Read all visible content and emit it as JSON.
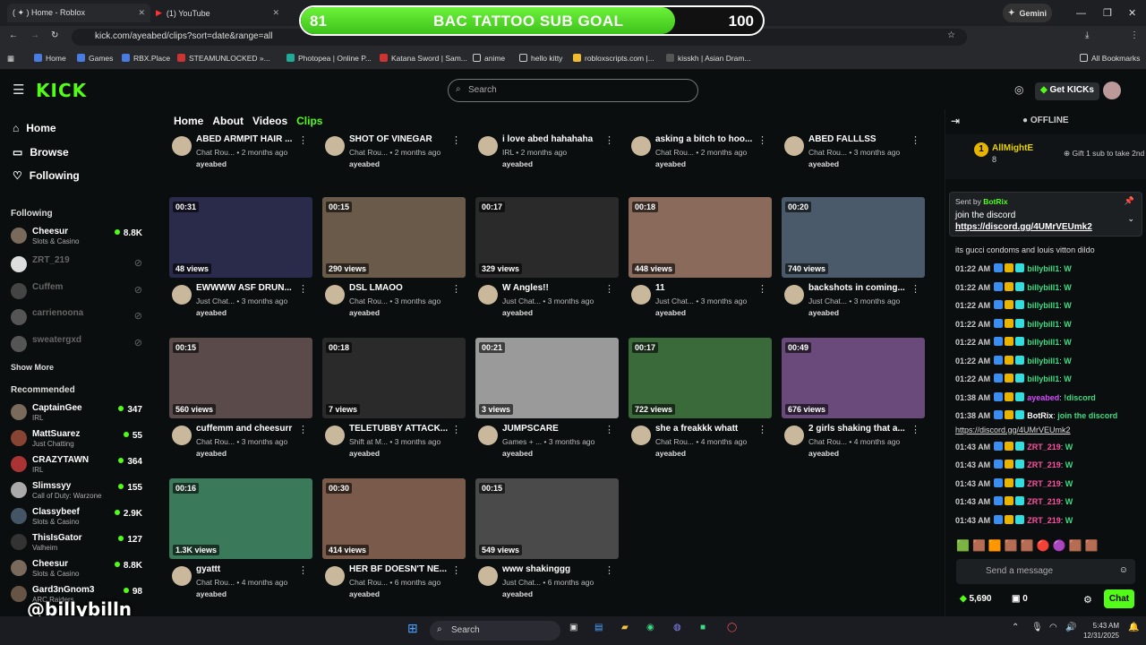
{
  "browser": {
    "tabs": [
      {
        "label": "( ✦ ) Home - Roblox"
      },
      {
        "label": "(1) YouTube"
      }
    ],
    "gemini": "Gemini",
    "url": "kick.com/ayeabed/clips?sort=date&range=all",
    "bookmarks": [
      "Home",
      "Games",
      "RBX.Place",
      "STEAMUNLOCKED »...",
      "Photopea | Online P...",
      "Katana Sword | Sam...",
      "anime",
      "hello kitty",
      "robloxscripts.com |...",
      "kisskh | Asian Dram..."
    ],
    "all_bookmarks": "All Bookmarks"
  },
  "goal": {
    "current": "81",
    "label": "BAC TATTOO SUB GOAL",
    "target": "100",
    "progress": 0.81
  },
  "site": {
    "logo": "KICK",
    "search_placeholder": "Search",
    "get_kicks": "Get KICKs"
  },
  "sidebar": {
    "home": "Home",
    "browse": "Browse",
    "following": "Following",
    "following_title": "Following",
    "following_list": [
      {
        "name": "Cheesur",
        "game": "Slots & Casino",
        "viewers": "8.8K",
        "live": true
      },
      {
        "name": "ZRT_219",
        "live": false
      },
      {
        "name": "Cuffem",
        "live": false
      },
      {
        "name": "carrienoona",
        "live": false
      },
      {
        "name": "sweatergxd",
        "live": false
      }
    ],
    "show_more": "Show More",
    "recommended_title": "Recommended",
    "recommended": [
      {
        "name": "CaptainGee",
        "game": "IRL",
        "viewers": "347"
      },
      {
        "name": "MattSuarez",
        "game": "Just Chatting",
        "viewers": "55"
      },
      {
        "name": "CRAZYTAWN",
        "game": "IRL",
        "viewers": "364"
      },
      {
        "name": "Slimssyy",
        "game": "Call of Duty: Warzone",
        "viewers": "155"
      },
      {
        "name": "Classybeef",
        "game": "Slots & Casino",
        "viewers": "2.9K"
      },
      {
        "name": "ThisIsGator",
        "game": "Valheim",
        "viewers": "127"
      },
      {
        "name": "Cheesur",
        "game": "Slots & Casino",
        "viewers": "8.8K"
      },
      {
        "name": "Gard3nGnom3",
        "game": "ARC Raiders",
        "viewers": "98"
      }
    ]
  },
  "channel_tabs": [
    "Home",
    "About",
    "Videos",
    "Clips"
  ],
  "clips": [
    {
      "title": "ABED ARMPIT HAIR ...",
      "cat": "Chat Rou...",
      "age": "2 months ago",
      "user": "ayeabed"
    },
    {
      "title": "SHOT OF VINEGAR",
      "cat": "Chat Rou...",
      "age": "2 months ago",
      "user": "ayeabed"
    },
    {
      "title": "i love abed hahahaha",
      "cat": "IRL",
      "age": "2 months ago",
      "user": "ayeabed"
    },
    {
      "title": "asking a bitch to hoo...",
      "cat": "Chat Rou...",
      "age": "2 months ago",
      "user": "ayeabed"
    },
    {
      "title": "ABED FALLLSS",
      "cat": "Chat Rou...",
      "age": "3 months ago",
      "user": "ayeabed"
    },
    {
      "dur": "00:31",
      "views": "48 views",
      "title": "EWWWW ASF DRUN...",
      "cat": "Just Chat...",
      "age": "3 months ago",
      "user": "ayeabed",
      "color": "#2a2a4a"
    },
    {
      "dur": "00:15",
      "views": "290 views",
      "title": "DSL LMAOO",
      "cat": "Chat Rou...",
      "age": "3 months ago",
      "user": "ayeabed",
      "color": "#6a5a4a"
    },
    {
      "dur": "00:17",
      "views": "329 views",
      "title": "W Angles!!",
      "cat": "Just Chat...",
      "age": "3 months ago",
      "user": "ayeabed",
      "color": "#2a2a2a"
    },
    {
      "dur": "00:18",
      "views": "448 views",
      "title": "11",
      "cat": "Just Chat...",
      "age": "3 months ago",
      "user": "ayeabed",
      "color": "#8a6a5a"
    },
    {
      "dur": "00:20",
      "views": "740 views",
      "title": "backshots in coming...",
      "cat": "Just Chat...",
      "age": "3 months ago",
      "user": "ayeabed",
      "color": "#4a5a6a"
    },
    {
      "dur": "00:15",
      "views": "560 views",
      "title": "cuffemm and cheesurr",
      "cat": "Chat Rou...",
      "age": "3 months ago",
      "user": "ayeabed",
      "color": "#5a4a4a"
    },
    {
      "dur": "00:18",
      "views": "7 views",
      "title": "TELETUBBY ATTACK...",
      "cat": "Shift at M...",
      "age": "3 months ago",
      "user": "ayeabed",
      "color": "#2a2a2a"
    },
    {
      "dur": "00:21",
      "views": "3 views",
      "title": "JUMPSCARE",
      "cat": "Games + ...",
      "age": "3 months ago",
      "user": "ayeabed",
      "color": "#9a9a9a"
    },
    {
      "dur": "00:17",
      "views": "722 views",
      "title": "she a freakkk whatt",
      "cat": "Chat Rou...",
      "age": "4 months ago",
      "user": "ayeabed",
      "color": "#3a6a3a"
    },
    {
      "dur": "00:49",
      "views": "676 views",
      "title": "2 girls shaking that a...",
      "cat": "Chat Rou...",
      "age": "4 months ago",
      "user": "ayeabed",
      "color": "#6a4a7a"
    },
    {
      "dur": "00:16",
      "views": "1.3K views",
      "title": "gyattt",
      "cat": "Chat Rou...",
      "age": "4 months ago",
      "user": "ayeabed",
      "color": "#3a7a5a"
    },
    {
      "dur": "00:30",
      "views": "414 views",
      "title": "HER BF DOESN'T NE...",
      "cat": "Chat Rou...",
      "age": "6 months ago",
      "user": "ayeabed",
      "color": "#7a5a4a"
    },
    {
      "dur": "00:15",
      "views": "549 views",
      "title": "www shakinggg",
      "cat": "Just Chat...",
      "age": "6 months ago",
      "user": "ayeabed",
      "color": "#4a4a4a"
    }
  ],
  "chat": {
    "offline": "OFFLINE",
    "gifter": "AllMightE",
    "gifter_count": "8",
    "gift_text": "Gift 1 sub to take 2nd",
    "pinned_by": "Sent by",
    "pinned_user": "BotRix",
    "pinned_text": "join the discord",
    "pinned_link": "https://discord.gg/4UMrVEUmk2",
    "partial": "its gucci condoms and louis vitton dildo",
    "messages": [
      {
        "time": "01:22 AM",
        "user": "billybill1",
        "color": "#3ddc84",
        "text": "W"
      },
      {
        "time": "01:22 AM",
        "user": "billybill1",
        "color": "#3ddc84",
        "text": "W"
      },
      {
        "time": "01:22 AM",
        "user": "billybill1",
        "color": "#3ddc84",
        "text": "W"
      },
      {
        "time": "01:22 AM",
        "user": "billybill1",
        "color": "#3ddc84",
        "text": "W"
      },
      {
        "time": "01:22 AM",
        "user": "billybill1",
        "color": "#3ddc84",
        "text": "W"
      },
      {
        "time": "01:22 AM",
        "user": "billybill1",
        "color": "#3ddc84",
        "text": "W"
      },
      {
        "time": "01:22 AM",
        "user": "billybill1",
        "color": "#3ddc84",
        "text": "W"
      },
      {
        "time": "01:38 AM",
        "user": "ayeabed",
        "color": "#d54bff",
        "text": "!discord"
      },
      {
        "time": "01:38 AM",
        "user": "BotRix",
        "color": "#ffffff",
        "text": "join the discord"
      },
      {
        "time": "01:43 AM",
        "user": "ZRT_219",
        "color": "#ff4fa0",
        "text": "W"
      },
      {
        "time": "01:43 AM",
        "user": "ZRT_219",
        "color": "#ff4fa0",
        "text": "W"
      },
      {
        "time": "01:43 AM",
        "user": "ZRT_219",
        "color": "#ff4fa0",
        "text": "W"
      },
      {
        "time": "01:43 AM",
        "user": "ZRT_219",
        "color": "#ff4fa0",
        "text": "W"
      },
      {
        "time": "01:43 AM",
        "user": "ZRT_219",
        "color": "#ff4fa0",
        "text": "W"
      }
    ],
    "botrix_link": "https://discord.gg/4UMrVEUmk2",
    "input_placeholder": "Send a message",
    "points": "5,690",
    "subs": "0",
    "chat_button": "Chat"
  },
  "overlay": "@billybilln",
  "taskbar": {
    "search": "Search",
    "time": "5:43 AM",
    "date": "12/31/2025"
  }
}
